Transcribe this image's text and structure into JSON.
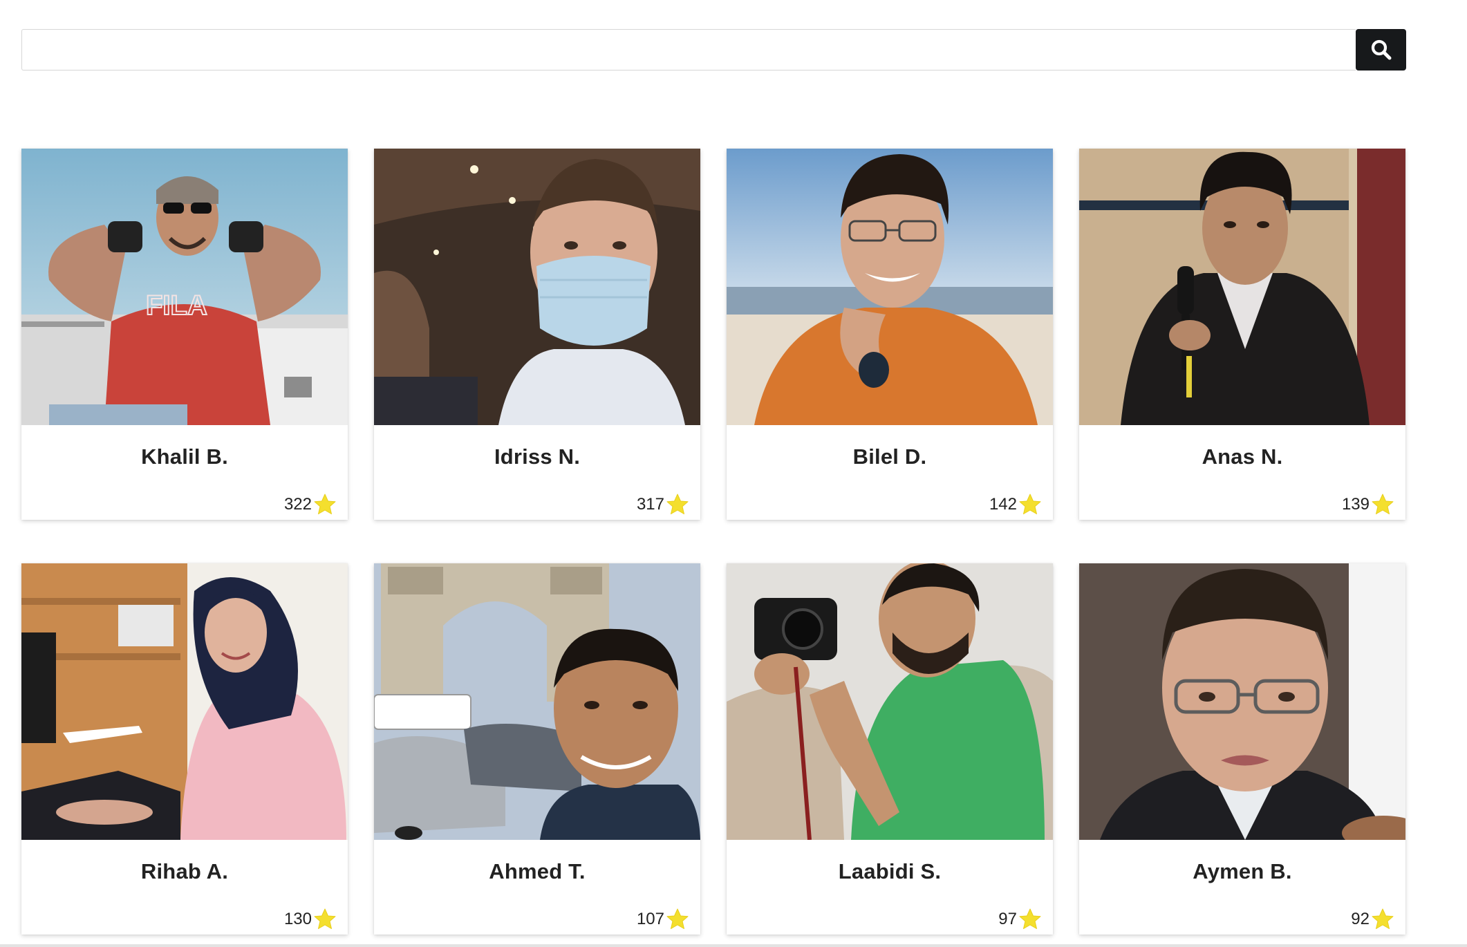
{
  "search": {
    "value": "",
    "placeholder": "",
    "button_icon": "search-icon"
  },
  "star_icon": "star-icon",
  "colors": {
    "search_button": "#17191b",
    "star": "#f4df2e"
  },
  "profiles": [
    {
      "name": "Khalil B.",
      "rating": "322"
    },
    {
      "name": "Idriss N.",
      "rating": "317"
    },
    {
      "name": "Bilel D.",
      "rating": "142"
    },
    {
      "name": "Anas N.",
      "rating": "139"
    },
    {
      "name": "Rihab A.",
      "rating": "130"
    },
    {
      "name": "Ahmed T.",
      "rating": "107"
    },
    {
      "name": "Laabidi S.",
      "rating": "97"
    },
    {
      "name": "Aymen B.",
      "rating": "92"
    }
  ]
}
